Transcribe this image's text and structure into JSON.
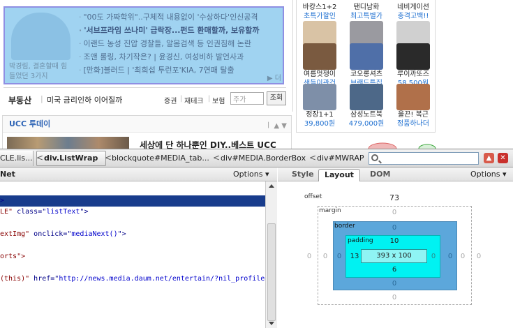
{
  "webpage": {
    "headlines": [
      {
        "text": "\"00도 가짜학위\"..구체적 내용없이 '수상하다'인신공격",
        "bold": false
      },
      {
        "text": "'서브프라임 쓰나미' 급락장...펀드 환매할까, 보유할까",
        "bold": true
      },
      {
        "text": "이랜드 농성 진압 경찰들, 알몸검색 등 인권침해 논란",
        "bold": false
      },
      {
        "text": "조앤 롤링, 차기작은? | 윤경신, 여성비하 발언사과",
        "bold": false
      },
      {
        "text": "[만화]블러드 | '최희섭 투런포'KIA, 7연패 탈출",
        "bold": false
      }
    ],
    "thumb_caption": "박경림, 결혼할때 힘들었던 3가지",
    "more_link": "▶ 더",
    "realestate": {
      "category": "부동산",
      "separator": "|",
      "title": "미국 금리인하 이어질까",
      "links": [
        "증권",
        "재테크",
        "보험"
      ],
      "link_separator": "|",
      "search_value": "주가",
      "search_button": "조회"
    },
    "ucc": {
      "heading": "UCC 투데이",
      "controls": "ㅣ ▲ ▼",
      "title": "세상에 단 하나뿐인 DIY..베스트 UCC"
    },
    "shop_items": [
      {
        "name": "바캉스1+2",
        "desc": "초특가할인",
        "color": "#d9c3a5"
      },
      {
        "name": "탠디남화",
        "desc": "최고특별가",
        "color": "#9a9aa0"
      },
      {
        "name": "네비게이션",
        "desc": "충격고백!!",
        "color": "#d0d0d0"
      },
      {
        "name": "여름멋쟁이",
        "desc": "샌들이관건",
        "color": "#7a5a40"
      },
      {
        "name": "코오롱셔츠",
        "desc": "브랜드특집",
        "color": "#4f6fa8"
      },
      {
        "name": "루이까또즈",
        "desc": "58,500원",
        "color": "#2a2a2a"
      },
      {
        "name": "정장1+1",
        "desc": "39,800원",
        "color": "#7e8fa8"
      },
      {
        "name": "삼성노트북",
        "desc": "479,000원",
        "color": "#4d6888"
      },
      {
        "name": "울끈! 복근",
        "desc": "정품하나더",
        "color": "#b0704a"
      }
    ]
  },
  "toolbar": {
    "crumbs": [
      {
        "label": "CLE.lis...",
        "selected": false
      },
      {
        "label": "div.ListWrap",
        "selected": true
      },
      {
        "label": "blockquote#MEDIA_tab...",
        "selected": false
      },
      {
        "label": "div#MEDIA.BorderBox",
        "selected": false
      },
      {
        "label": "div#MWRAP",
        "selected": false
      }
    ],
    "crumb_separator": "<",
    "search_value": "",
    "minimize_glyph": "▲",
    "close_glyph": "✕"
  },
  "html_panel": {
    "title": "Net",
    "options": "Options ▾",
    "lines": [
      [
        {
          "t": ">",
          "c": "tag"
        }
      ],
      [
        {
          "t": "LE\" ",
          "c": "val"
        },
        {
          "t": "class",
          "c": "tag"
        },
        {
          "t": "=\"",
          "c": "tag"
        },
        {
          "t": "listText",
          "c": "val"
        },
        {
          "t": "\">",
          "c": "tag"
        }
      ],
      [],
      [
        {
          "t": "extImg\" ",
          "c": "val"
        },
        {
          "t": "onclick",
          "c": "tag"
        },
        {
          "t": "=\"",
          "c": "tag"
        },
        {
          "t": "mediaNext()",
          "c": "val"
        },
        {
          "t": "\">",
          "c": "tag"
        }
      ],
      [],
      [
        {
          "t": "orts\">",
          "c": "val"
        }
      ],
      [],
      [
        {
          "t": "(this)\" ",
          "c": "val"
        },
        {
          "t": "href",
          "c": "tag"
        },
        {
          "t": "=\"",
          "c": "tag"
        },
        {
          "t": "http://news.media.daum.net/entertain/?nil_profile=",
          "c": "val"
        }
      ]
    ]
  },
  "layout_panel": {
    "tabs": [
      "Style",
      "Layout",
      "DOM"
    ],
    "active_tab": "Layout",
    "options": "Options ▾",
    "offset_label": "offset",
    "offset_value": "73",
    "margin_label": "margin",
    "border_label": "border",
    "padding_label": "padding",
    "offset_left": "0",
    "margin": {
      "top": "0",
      "right": "0",
      "bottom": "0",
      "left": "0"
    },
    "border": {
      "top": "0",
      "right": "0",
      "bottom": "0",
      "left": "0"
    },
    "padding": {
      "top": "10",
      "right": "0",
      "bottom": "6",
      "left": "13"
    },
    "content_size": "393 x 100",
    "extra_zero": "0"
  }
}
